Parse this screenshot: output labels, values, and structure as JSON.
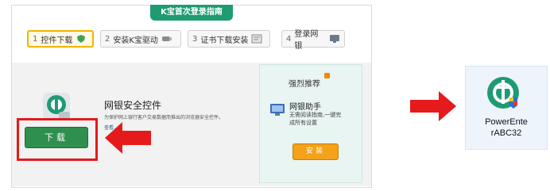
{
  "header": {
    "title": "K宝首次登录指南"
  },
  "steps": [
    {
      "number": "1",
      "label": "控件下载",
      "active": true,
      "icon": "shield-icon"
    },
    {
      "number": "2",
      "label": "安装K宝驱动",
      "active": false,
      "icon": "usb-key-icon"
    },
    {
      "number": "3",
      "label": "证书下载安装",
      "active": false,
      "icon": "certificate-icon"
    },
    {
      "number": "4",
      "label": "登录网银",
      "active": false,
      "icon": "monitor-icon"
    }
  ],
  "plugin": {
    "title": "网银安全控件",
    "description": "为保护网上银行客户交易数据而推出的浏览器安全控件。",
    "link": "查看...",
    "download_label": "下载"
  },
  "recommend": {
    "title": "强烈推荐",
    "helper_title": "网银助手",
    "helper_desc": "无需阅读指南,一键完成所有设置",
    "install_label": "安装"
  },
  "desktop_icon": {
    "label": "PowerEnte\nrABC32"
  },
  "colors": {
    "brand_green": "#1f9b74",
    "download_green": "#2f8f4f",
    "install_orange": "#f3a21a",
    "highlight_red": "#e51a1a",
    "active_step_border": "#f2b400"
  }
}
